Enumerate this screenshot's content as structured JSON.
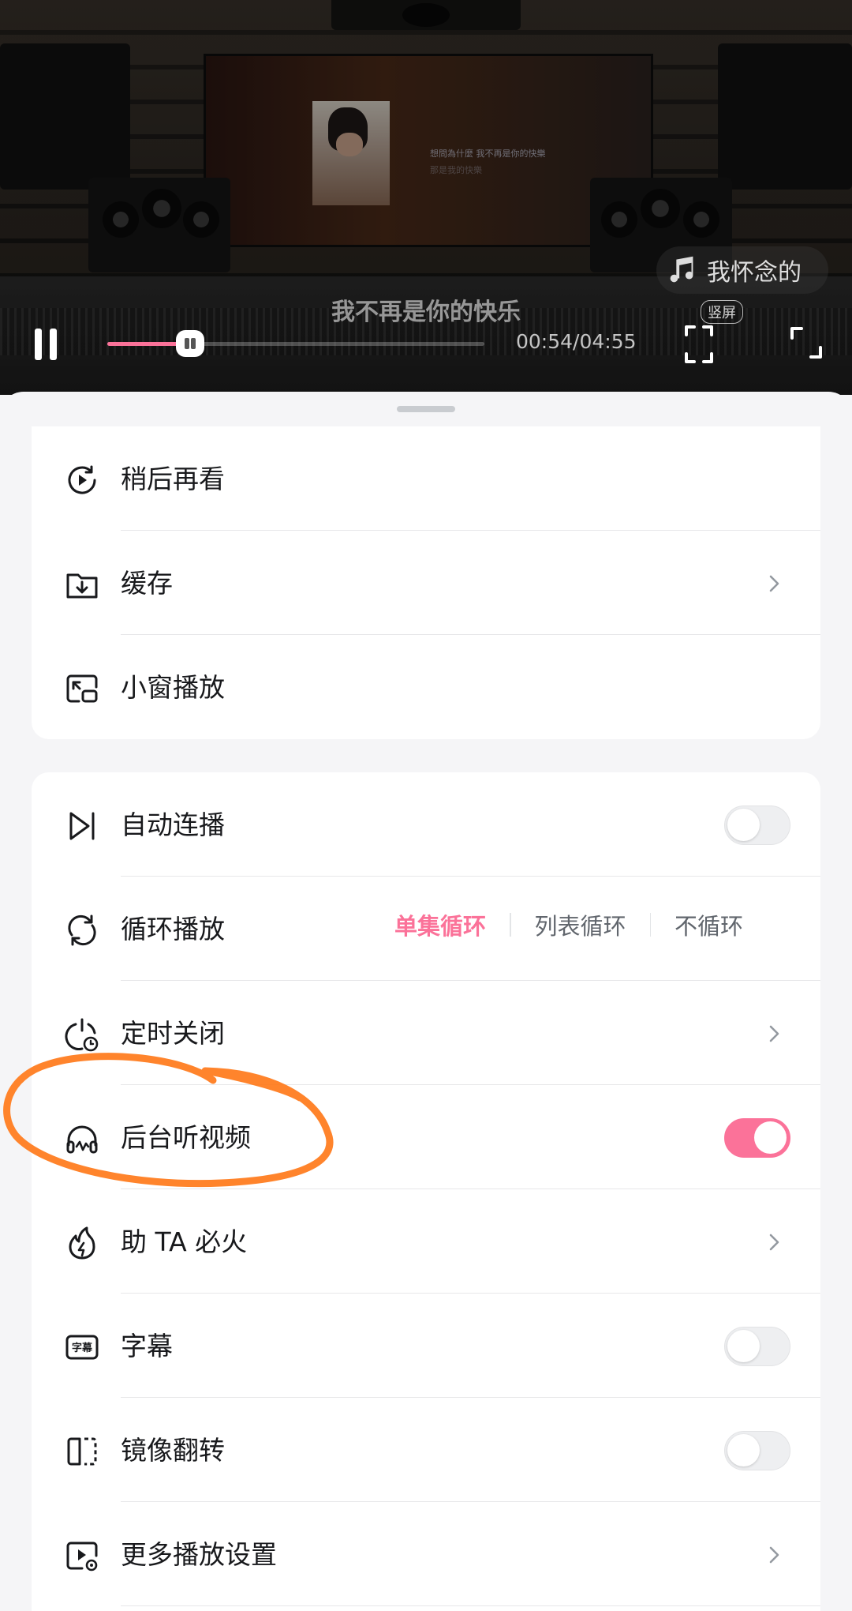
{
  "video": {
    "screen_lyrics": [
      "想問為什麼 我不再是你的快樂",
      "那是我的快樂"
    ],
    "subtitle": "我不再是你的快乐",
    "music_tag": "我怀念的",
    "time": "00:54/04:55",
    "progress": 0.22,
    "vertical_label": "竖屏"
  },
  "menu_top": [
    {
      "label": "稍后再看",
      "icon": "watch-later-icon",
      "accessory": "none"
    },
    {
      "label": "缓存",
      "icon": "download-cache-icon",
      "accessory": "chevron"
    },
    {
      "label": "小窗播放",
      "icon": "mini-window-icon",
      "accessory": "none"
    }
  ],
  "menu_main": {
    "autoplay": {
      "label": "自动连播",
      "on": false
    },
    "loop": {
      "label": "循环播放",
      "options": [
        "单集循环",
        "列表循环",
        "不循环"
      ],
      "selected": "单集循环"
    },
    "timer": {
      "label": "定时关闭"
    },
    "background": {
      "label": "后台听视频",
      "on": true
    },
    "boost": {
      "label": "助 TA 必火"
    },
    "subtitles": {
      "label": "字幕",
      "icon_text": "字幕",
      "on": false
    },
    "mirror": {
      "label": "镜像翻转",
      "on": false
    },
    "more": {
      "label": "更多播放设置"
    }
  },
  "colors": {
    "accent": "#fb7299",
    "annotation": "#ff7a1a"
  }
}
